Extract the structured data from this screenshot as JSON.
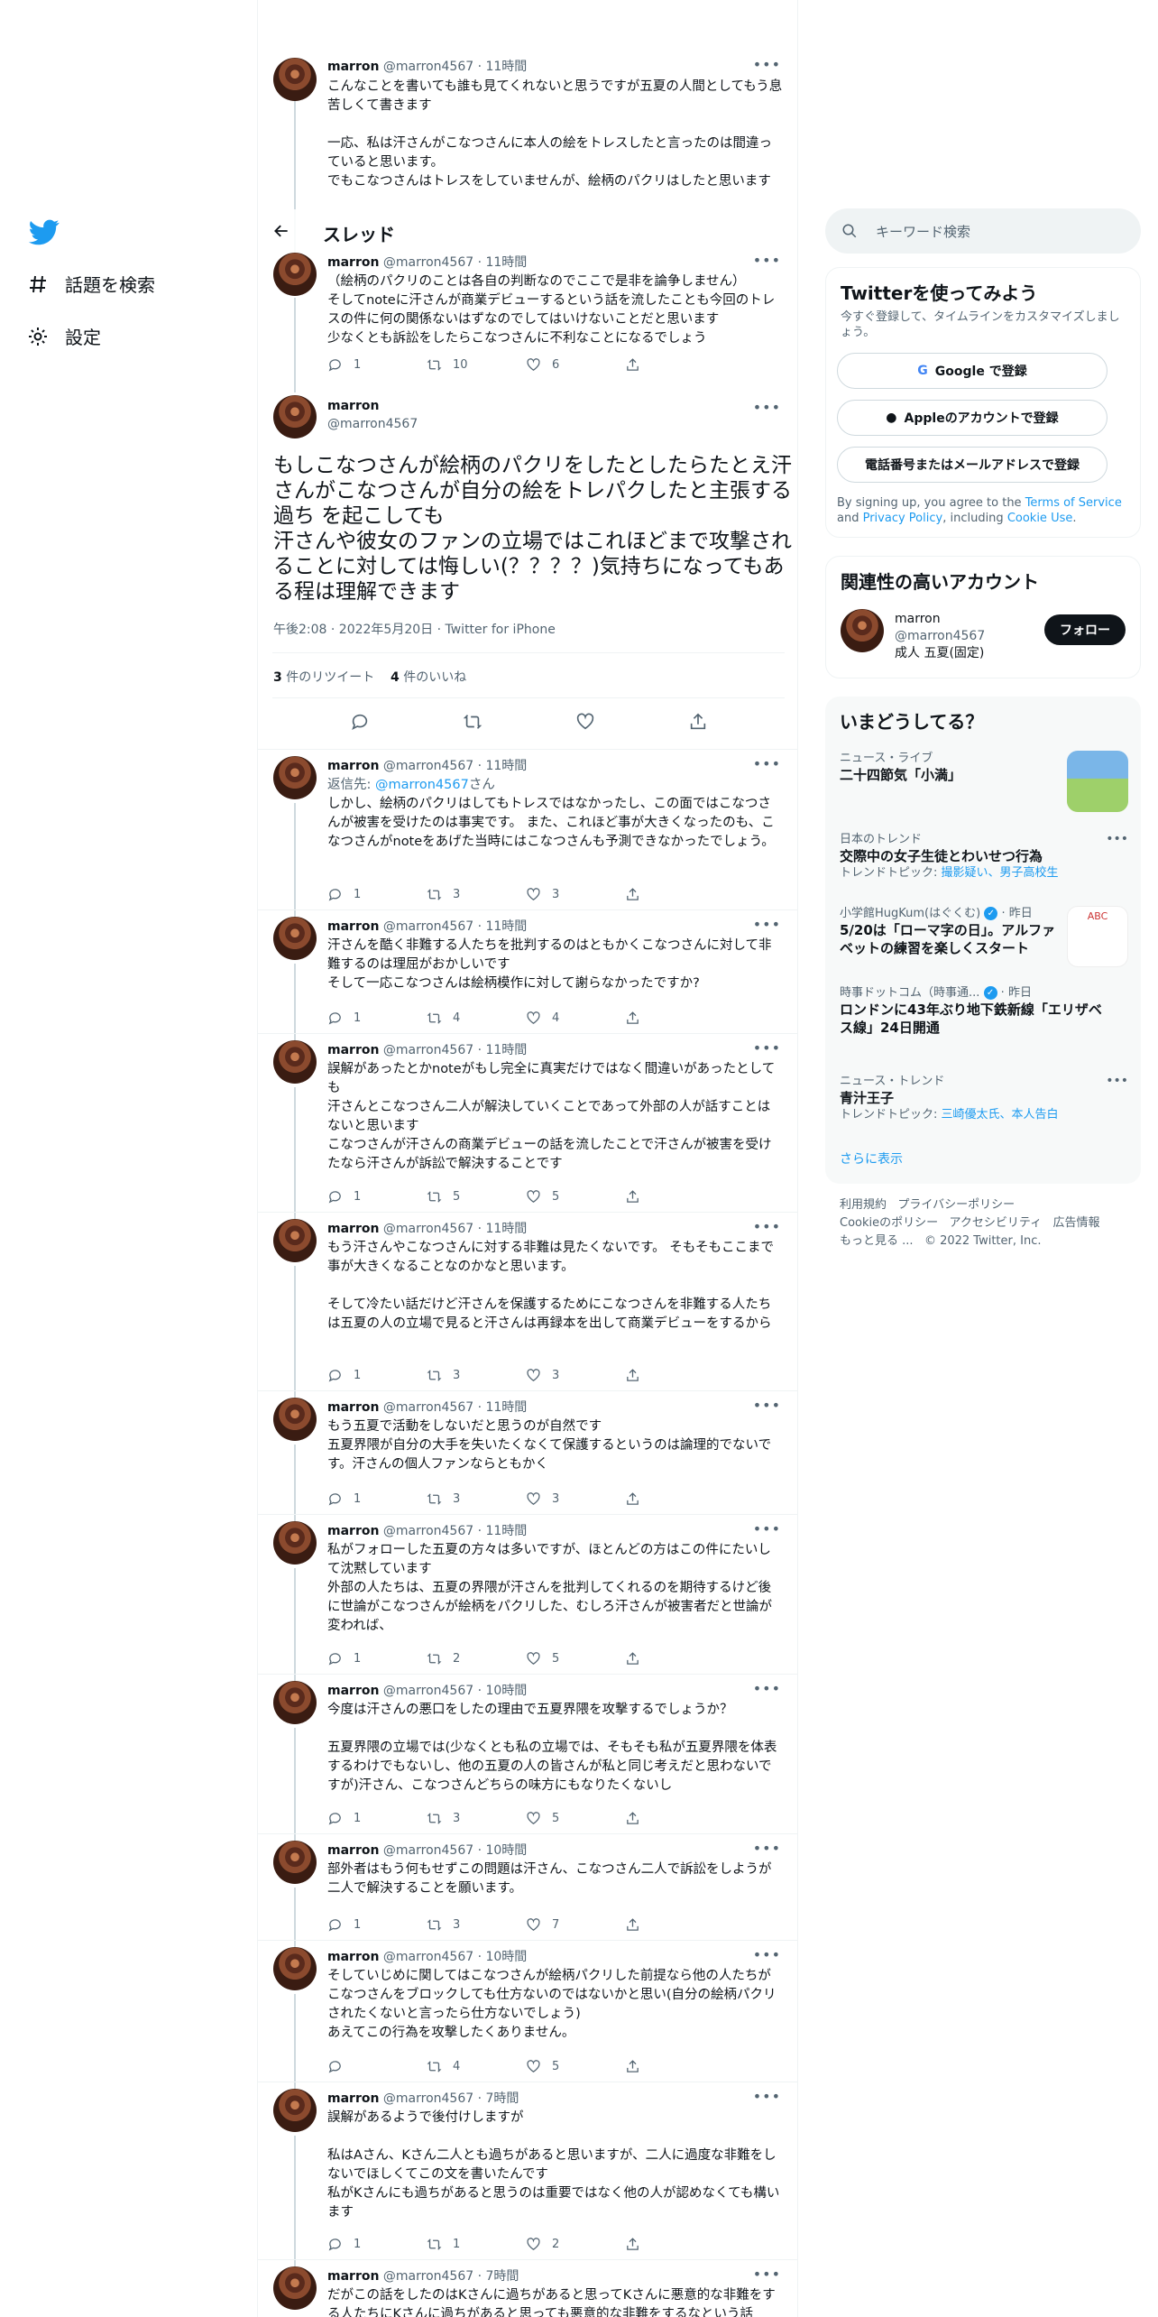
{
  "nav": {
    "explore": "話題を検索",
    "settings": "設定"
  },
  "header": {
    "title": "スレッド"
  },
  "top_tweet": {
    "name": "marron",
    "meta": "@marron4567 · 11時間",
    "text": "こんなことを書いても誰も見てくれないと思うですが五夏の人間としてもう息苦しくて書きます\n\n一応、私は汗さんがこなつさんに本人の絵をトレスしたと言ったのは間違っていると思います。\nでもこなつさんはトレスをしていませんが、絵柄のパクリはしたと思います"
  },
  "prev_tweet": {
    "name": "marron",
    "meta": "@marron4567 · 11時間",
    "text": "（絵柄のパクリのことは各自の判断なのでここで是非を論争しません）\nそしてnoteに汗さんが商業デビューするという話を流したことも今回のトレスの件に何の関係ないはずなのでしてはいけないことだと思います\n少なくとも訴訟をしたらこなつさんに不利なことになるでしょう",
    "reply": "1",
    "retweet": "10",
    "like": "6"
  },
  "main_tweet": {
    "name": "marron",
    "handle": "@marron4567",
    "text": "もしこなつさんが絵柄のパクリをしたとしたらたとえ汗さんがこなつさんが自分の絵をトレパクしたと主張する過ち を起こしても\n汗さんや彼女のファンの立場ではこれほどまで攻撃されることに対しては悔しい(？？？？)気持ちになってもある程は理解できます",
    "meta": "午後2:08 · 2022年5月20日 · Twitter for iPhone",
    "retweets": "3",
    "retweets_label": "件のリツイート",
    "likes": "4",
    "likes_label": "件のいいね"
  },
  "replies": [
    {
      "meta": "@marron4567 · 11時間",
      "reply_to": "返信先: ",
      "reply_handle": "@marron4567",
      "reply_suffix": "さん",
      "text": "しかし、絵柄のパクリはしてもトレスではなかったし、この面ではこなつさんが被害を受けたのは事実です。 また、これほど事が大きくなったのも、こなつさんがnoteをあげた当時にはこなつさんも予測できなかったでしょう。",
      "reply": "1",
      "retweet": "3",
      "like": "3"
    },
    {
      "meta": "@marron4567 · 11時間",
      "text": "汗さんを酷く非難する人たちを批判するのはともかくこなつさんに対して非難するのは理屈がおかしいです\nそして一応こなつさんは絵柄模作に対して謝らなかったですか?",
      "reply": "1",
      "retweet": "4",
      "like": "4"
    },
    {
      "meta": "@marron4567 · 11時間",
      "text": "誤解があったとかnoteがもし完全に真実だけではなく間違いがあったとしても\n汗さんとこなつさん二人が解決していくことであって外部の人が話すことはないと思います\nこなつさんが汗さんの商業デビューの話を流したことで汗さんが被害を受けたなら汗さんが訴訟で解決することです",
      "reply": "1",
      "retweet": "5",
      "like": "5"
    },
    {
      "meta": "@marron4567 · 11時間",
      "text": "もう汗さんやこなつさんに対する非難は見たくないです。 そもそもここまで事が大きくなることなのかなと思います。\n\nそして冷たい話だけど汗さんを保護するためにこなつさんを非難する人たちは五夏の人の立場で見ると汗さんは再録本を出して商業デビューをするから",
      "reply": "1",
      "retweet": "3",
      "like": "3"
    },
    {
      "meta": "@marron4567 · 11時間",
      "text": "もう五夏で活動をしないだと思うのが自然です\n五夏界隈が自分の大手を失いたくなくて保護するというのは論理的でないです。汗さんの個人ファンならともかく",
      "reply": "1",
      "retweet": "3",
      "like": "3"
    },
    {
      "meta": "@marron4567 · 11時間",
      "text": "私がフォローした五夏の方々は多いですが、ほとんどの方はこの件にたいして沈黙しています\n外部の人たちは、五夏の界隈が汗さんを批判してくれるのを期待するけど後に世論がこなつさんが絵柄をパクリした、むしろ汗さんが被害者だと世論が変われば、",
      "reply": "1",
      "retweet": "2",
      "like": "5"
    },
    {
      "meta": "@marron4567 · 10時間",
      "text": "今度は汗さんの悪口をしたの理由で五夏界隈を攻撃するでしょうか？\n\n五夏界隈の立場では(少なくとも私の立場では、そもそも私が五夏界隈を体表するわけでもないし、他の五夏の人の皆さんが私と同じ考えだと思わないですが)汗さん、こなつさんどちらの味方にもなりたくないし",
      "reply": "1",
      "retweet": "3",
      "like": "5"
    },
    {
      "meta": "@marron4567 · 10時間",
      "text": "部外者はもう何もせずこの問題は汗さん、こなつさん二人で訴訟をしようが二人で解決することを願います。",
      "reply": "1",
      "retweet": "3",
      "like": "7"
    },
    {
      "meta": "@marron4567 · 10時間",
      "text": "そしていじめに関してはこなつさんが絵柄パクリした前提なら他の人たちがこなつさんをブロックしても仕方ないのではないかと思い(自分の絵柄パクリされたくないと言ったら仕方ないでしょう)\nあえてこの行為を攻撃したくありません。",
      "reply": "",
      "retweet": "4",
      "like": "5"
    },
    {
      "meta": "@marron4567 · 7時間",
      "text": "誤解があるようで後付けしますが\n\n私はAさん、Kさん二人とも過ちがあると思いますが、二人に過度な非難をしないでほしくてこの文を書いたんです\n私がKさんにも過ちがあると思うのは重要ではなく他の人が認めなくても構います",
      "reply": "1",
      "retweet": "1",
      "like": "2"
    },
    {
      "meta": "@marron4567 · 7時間",
      "text": "だがこの話をしたのはKさんに過ちがあると思ってKさんに悪意的な非難をする人たちにKさんに過ちがあると思っても悪意的な非難をするなという話",
      "reply": "",
      "retweet": "",
      "like": ""
    }
  ],
  "reply_name": "marron",
  "sidebar": {
    "search_placeholder": "キーワード検索",
    "signup_title": "Twitterを使ってみよう",
    "signup_sub": "今すぐ登録して、タイムラインをカスタマイズしましょう。",
    "google_btn": "Google で登録",
    "apple_btn": "Appleのアカウントで登録",
    "phone_btn": "電話番号またはメールアドレスで登録",
    "terms_pre": "By signing up, you agree to the ",
    "terms_link": "Terms of Service",
    "terms_mid": " and ",
    "privacy_link": "Privacy Policy",
    "terms_inc": ", including ",
    "cookie_link": "Cookie Use",
    "terms_end": ".",
    "related_title": "関連性の高いアカウント",
    "related_name": "marron",
    "related_handle": "@marron4567",
    "related_bio": "成人 五夏(固定)",
    "follow_btn": "フォロー",
    "trends_title": "いまどうしてる？",
    "trends": [
      {
        "context": "ニュース・ライブ",
        "title": "二十四節気「小満」",
        "topics": ""
      },
      {
        "context": "日本のトレンド",
        "title": "交際中の女子生徒とわいせつ行為",
        "topics_label": "トレンドトピック: ",
        "topics": "撮影疑い、男子高校生"
      },
      {
        "context": "小学館HugKum(はぐくむ)",
        "context_suffix": " · 昨日",
        "title": "5/20は「ローマ字の日」。アルファベットの練習を楽しくスタート",
        "topics": ""
      },
      {
        "context": "時事ドットコム（時事通...",
        "context_suffix": " · 昨日",
        "title": "ロンドンに43年ぶり地下鉄新線「エリザベス線」24日開通",
        "topics": ""
      },
      {
        "context": "ニュース・トレンド",
        "title": "青汁王子",
        "topics_label": "トレンドトピック: ",
        "topics": "三崎優太氏、本人告白"
      }
    ],
    "show_more": "さらに表示",
    "footer_1": "利用規約",
    "footer_2": "プライバシーポリシー",
    "footer_3": "Cookieのポリシー",
    "footer_4": "アクセシビリティ",
    "footer_5": "広告情報",
    "footer_6": "もっと見る ...",
    "footer_7": "© 2022 Twitter, Inc."
  },
  "colors": {
    "accent": "#1d9bf0",
    "text": "#0f1419",
    "muted": "#536471"
  }
}
